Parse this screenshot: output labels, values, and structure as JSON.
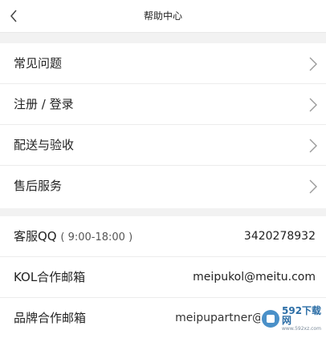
{
  "header": {
    "title": "帮助中心"
  },
  "menu": [
    {
      "label": "常见问题"
    },
    {
      "label": "注册 / 登录"
    },
    {
      "label": "配送与验收"
    },
    {
      "label": "售后服务"
    }
  ],
  "contact": {
    "qq_label": "客服QQ",
    "qq_hours": "( 9:00-18:00 )",
    "qq_value": "3420278932",
    "kol_label": "KOL合作邮箱",
    "kol_value": "meipukol@meitu.com",
    "brand_label": "品牌合作邮箱",
    "brand_value": "meipupartner@"
  },
  "watermark": {
    "main": "592下载网",
    "sub": "www.592xz.com"
  },
  "colors": {
    "background": "#f2f2f2",
    "card": "#ffffff",
    "divider": "#ececec",
    "text": "#222222",
    "chevron": "#9a9a9a"
  }
}
